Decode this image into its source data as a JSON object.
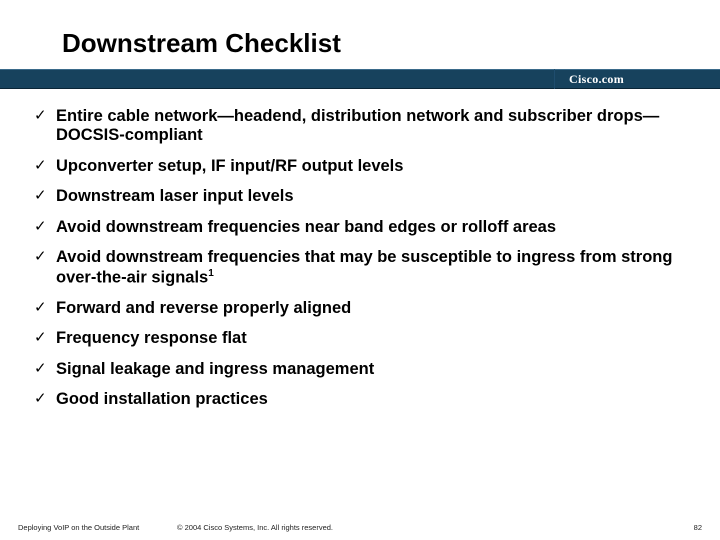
{
  "title": "Downstream Checklist",
  "brand": "Cisco.com",
  "checklist": {
    "item0": "Entire cable network—headend, distribution network and subscriber drops—DOCSIS-compliant",
    "item1": "Upconverter setup, IF input/RF output levels",
    "item2": "Downstream laser input levels",
    "item3": "Avoid downstream frequencies near band edges or rolloff areas",
    "item4_a": "Avoid downstream frequencies that may be susceptible to ingress from strong over-the-air signals",
    "item4_sup": "1",
    "item5": "Forward and reverse properly aligned",
    "item6": "Frequency response flat",
    "item7": "Signal leakage and ingress management",
    "item8": "Good installation practices"
  },
  "footer": {
    "session": "Deploying VoIP on the Outside Plant",
    "copyright": "© 2004 Cisco Systems, Inc. All rights reserved.",
    "page": "82"
  }
}
